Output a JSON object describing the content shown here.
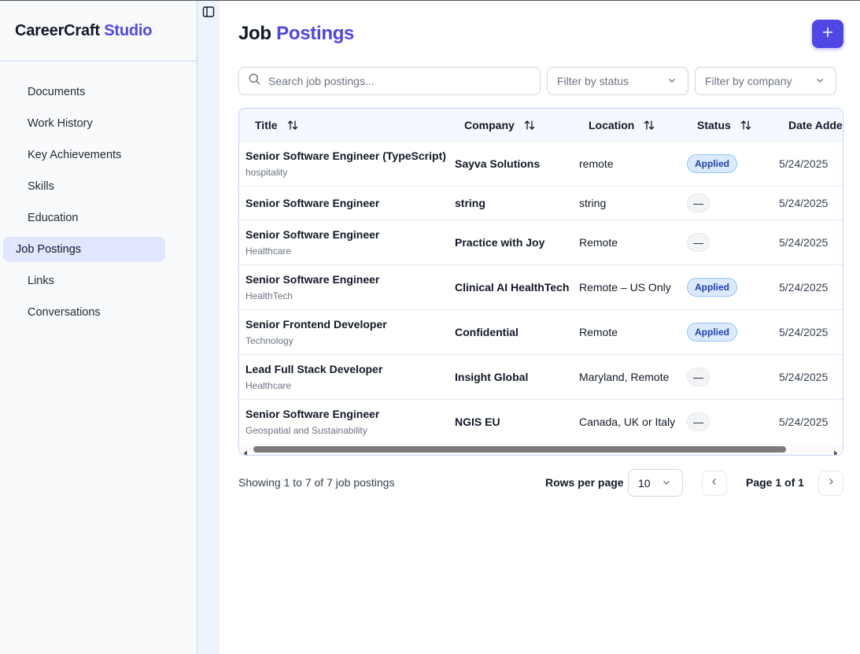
{
  "brand": {
    "part1": "CareerCraft",
    "part2": "Studio"
  },
  "sidebar": {
    "items": [
      {
        "label": "Documents",
        "active": false
      },
      {
        "label": "Work History",
        "active": false
      },
      {
        "label": "Key Achievements",
        "active": false
      },
      {
        "label": "Skills",
        "active": false
      },
      {
        "label": "Education",
        "active": false
      },
      {
        "label": "Job Postings",
        "active": true
      },
      {
        "label": "Links",
        "active": false
      },
      {
        "label": "Conversations",
        "active": false
      }
    ]
  },
  "header": {
    "title_part1": "Job",
    "title_part2": "Postings",
    "add_icon": "plus-icon"
  },
  "search": {
    "placeholder": "Search job postings...",
    "value": ""
  },
  "filters": {
    "status_placeholder": "Filter by status",
    "company_placeholder": "Filter by company"
  },
  "table": {
    "columns": [
      "Title",
      "Company",
      "Location",
      "Status",
      "Date Added"
    ],
    "rows": [
      {
        "title": "Senior Software Engineer (TypeScript)",
        "subtitle": "hospitality",
        "company": "Sayva Solutions",
        "location": "remote",
        "status": "Applied",
        "date": "5/24/2025"
      },
      {
        "title": "Senior Software Engineer",
        "subtitle": "",
        "company": "string",
        "location": "string",
        "status": "—",
        "date": "5/24/2025"
      },
      {
        "title": "Senior Software Engineer",
        "subtitle": "Healthcare",
        "company": "Practice with Joy",
        "location": "Remote",
        "status": "—",
        "date": "5/24/2025"
      },
      {
        "title": "Senior Software Engineer",
        "subtitle": "HealthTech",
        "company": "Clinical AI HealthTech",
        "location": "Remote – US Only",
        "status": "Applied",
        "date": "5/24/2025"
      },
      {
        "title": "Senior Frontend Developer",
        "subtitle": "Technology",
        "company": "Confidential",
        "location": "Remote",
        "status": "Applied",
        "date": "5/24/2025"
      },
      {
        "title": "Lead Full Stack Developer",
        "subtitle": "Healthcare",
        "company": "Insight Global",
        "location": "Maryland, Remote",
        "status": "—",
        "date": "5/24/2025"
      },
      {
        "title": "Senior Software Engineer",
        "subtitle": "Geospatial and Sustainability",
        "company": "NGIS EU",
        "location": "Canada, UK or Italy",
        "status": "—",
        "date": "5/24/2025"
      }
    ]
  },
  "footer": {
    "showing": "Showing 1 to 7 of 7 job postings",
    "rows_per_page_label": "Rows per page",
    "rows_per_page_value": "10",
    "page_label": "Page 1 of 1"
  },
  "colors": {
    "accent": "#4f46e5",
    "badge_bg": "#dbeafe",
    "badge_text": "#1e40af",
    "active_nav": "#e0e7ff"
  }
}
